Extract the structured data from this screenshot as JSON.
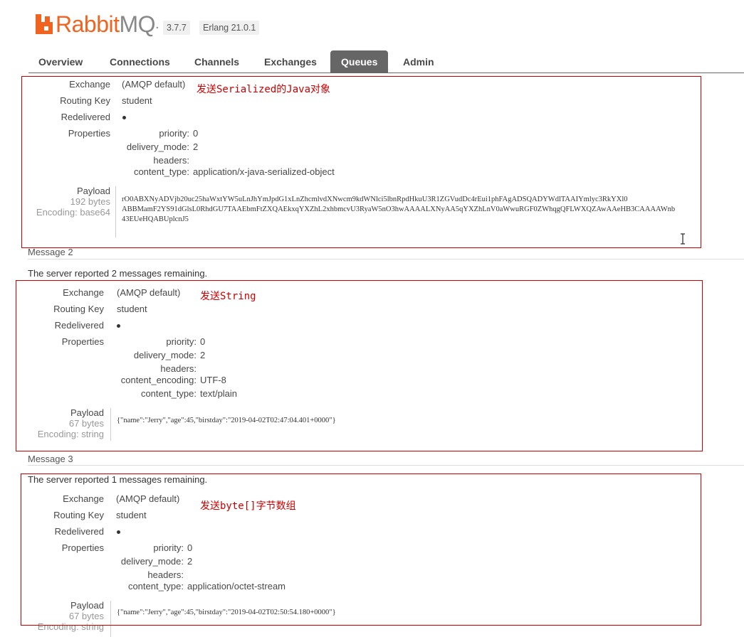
{
  "header": {
    "logo_rabbit": "Rabbit",
    "logo_mq": "MQ",
    "logo_tm": ".",
    "version": "3.7.7",
    "erlang": "Erlang 21.0.1"
  },
  "nav": {
    "tabs": [
      "Overview",
      "Connections",
      "Channels",
      "Exchanges",
      "Queues",
      "Admin"
    ],
    "active": "Queues"
  },
  "labels": {
    "exchange": "Exchange",
    "routing_key": "Routing Key",
    "redelivered": "Redelivered",
    "properties": "Properties",
    "payload": "Payload"
  },
  "messages": [
    {
      "annotation": "发送Serialized的Java对象",
      "exchange": "(AMQP default)",
      "routing_key": "student",
      "properties": [
        {
          "key": "priority:",
          "value": "0"
        },
        {
          "key": "delivery_mode:",
          "value": "2"
        },
        {
          "key": "headers:",
          "value": ""
        },
        {
          "key": "content_type:",
          "value": "application/x-java-serialized-object"
        }
      ],
      "payload_size": "192 bytes",
      "encoding": "Encoding: base64",
      "payload_lines": [
        "rO0ABXNyADVjb20uc25haWxtYW5uLnJhYmJpdG1xLnZhcmlvdXNwcm9kdWNlci5lbnRpdHkuU3R1ZGVudDc4rEui1phFAgADSQADYWdlTAAIYmlyc3RkYXl0",
        "ABBMamF2YS91dGlsL0RhdGU7TAAEbmFtZXQAEkxqYXZhL2xhbmcvU3RyaW5nO3hwAAAALXNyAA5qYXZhLnV0aWwuRGF0ZWhqgQFLWXQZAwAAeHB3CAAAAWnb",
        "43EUeHQABUplcnJ5"
      ]
    },
    {
      "header": "Message 2",
      "remaining": "The server reported 2 messages remaining.",
      "annotation": "发送String",
      "exchange": "(AMQP default)",
      "routing_key": "student",
      "properties": [
        {
          "key": "priority:",
          "value": "0"
        },
        {
          "key": "delivery_mode:",
          "value": "2"
        },
        {
          "key": "headers:",
          "value": ""
        },
        {
          "key": "content_encoding:",
          "value": "UTF-8"
        },
        {
          "key": "content_type:",
          "value": "text/plain"
        }
      ],
      "payload_size": "67 bytes",
      "encoding": "Encoding: string",
      "payload_lines": [
        "{\"name\":\"Jerry\",\"age\":45,\"birstday\":\"2019-04-02T02:47:04.401+0000\"}"
      ]
    },
    {
      "header": "Message 3",
      "remaining": "The server reported 1 messages remaining.",
      "annotation": "发送byte[]字节数组",
      "exchange": "(AMQP default)",
      "routing_key": "student",
      "properties": [
        {
          "key": "priority:",
          "value": "0"
        },
        {
          "key": "delivery_mode:",
          "value": "2"
        },
        {
          "key": "headers:",
          "value": ""
        },
        {
          "key": "content_type:",
          "value": "application/octet-stream"
        }
      ],
      "payload_size": "67 bytes",
      "encoding": "Encoding: string",
      "payload_lines": [
        "{\"name\":\"Jerry\",\"age\":45,\"birstday\":\"2019-04-02T02:50:54.180+0000\"}"
      ]
    }
  ],
  "colors": {
    "brand_orange": "#f06420",
    "active_tab": "#666666",
    "annotation_red": "#cc0000"
  },
  "icons": [
    "rabbitmq-logo-icon",
    "text-cursor-icon"
  ]
}
